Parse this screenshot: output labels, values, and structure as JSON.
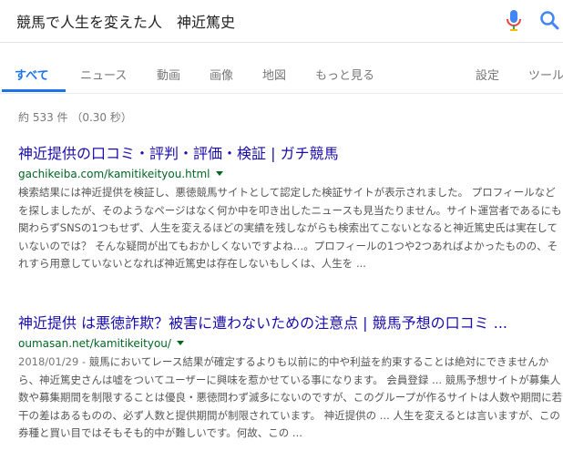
{
  "search": {
    "query": "競馬で人生を変えた人　神近篤史"
  },
  "icons": {
    "mic": "microphone-icon",
    "search": "search-icon"
  },
  "colors": {
    "accent": "#1a73e8",
    "link": "#1a0dab",
    "url": "#006621"
  },
  "tabs": [
    {
      "label": "すべて",
      "active": true
    },
    {
      "label": "ニュース"
    },
    {
      "label": "動画"
    },
    {
      "label": "画像"
    },
    {
      "label": "地図"
    },
    {
      "label": "もっと見る"
    },
    {
      "label": "設定"
    },
    {
      "label": "ツール"
    }
  ],
  "stats": "約 533 件 （0.30 秒）",
  "results": [
    {
      "title": "神近提供の口コミ・評判・評価・検証 | ガチ競馬",
      "url": "gachikeiba.com/kamitikeityou.html",
      "date": "",
      "snippet": "検索結果には神近提供を検証し、悪徳競馬サイトとして認定した検証サイトが表示されました。 プロフィールなどを探しましたが、そのようなページはなく何か中を叩き出したニュースも見当たりません。サイト運営者であるにも関わらずSNSの1つもせず、人生を変えるほどの実績を残しながらも検索出てこないとなると神近篤史氏は実在していないのでは？ そんな疑問が出てもおかしくないですよね…。プロフィールの1つや2つあればよかったものの、それすら用意していないとなれば神近篤史は存在しないもしくは、人生を ..."
    },
    {
      "title": "神近提供 は悪徳詐欺？被害に遭わないための注意点 | 競馬予想の口コミ ...",
      "url": "oumasan.net/kamitikeityou/",
      "date": "2018/01/29 - ",
      "snippet": "競馬においてレース結果が確定するよりも以前に的中や利益を約束することは絶対にできませんから、神近篤史さんは嘘をついてユーザーに興味を惹かせている事になります。 会員登録 ... 競馬予想サイトが募集人数や募集期間を制限することは優良・悪徳問わず滅多にないのですが、このグループが作るサイトは人数や期間に若干の差はあるものの、必ず人数と提供期間が制限されています。 神近提供の ... 人生を変えるとは言いますが、この券種と買い目ではそもそも的中が難しいです。何故、この ..."
    }
  ]
}
